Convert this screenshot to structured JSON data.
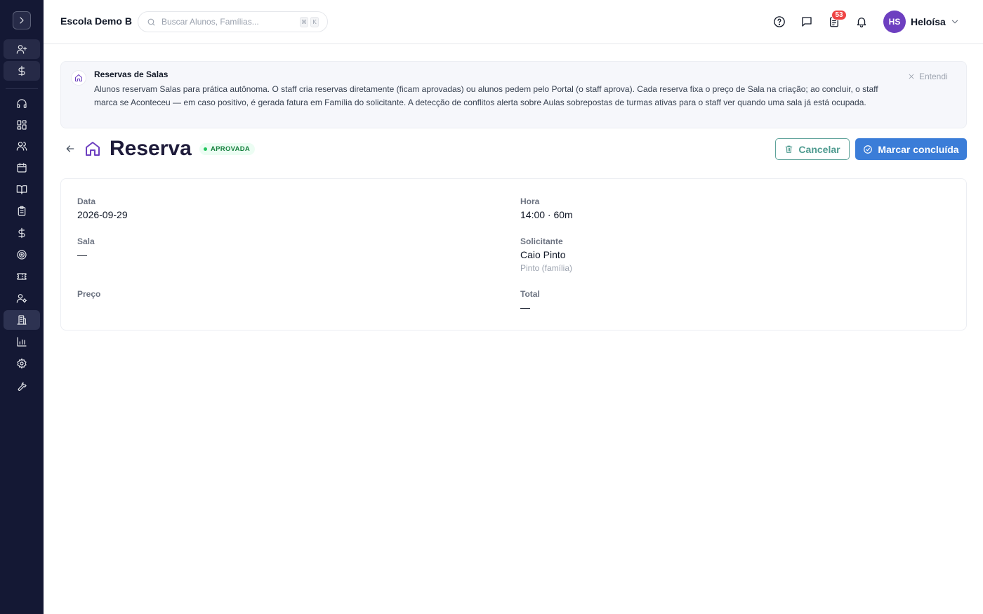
{
  "header": {
    "school_name": "Escola Demo B",
    "search_placeholder": "Buscar Alunos, Famílias...",
    "shortcut_keys": [
      "⌘",
      "K"
    ],
    "notification_count": "53",
    "user_initials": "HS",
    "user_name": "Heloísa"
  },
  "sidebar": {
    "items": [
      {
        "icon": "user-plus-icon"
      },
      {
        "icon": "dollar-icon"
      },
      {
        "icon": "headset-icon"
      },
      {
        "icon": "grid-icon"
      },
      {
        "icon": "users-icon"
      },
      {
        "icon": "calendar-icon"
      },
      {
        "icon": "book-icon"
      },
      {
        "icon": "clipboard-icon"
      },
      {
        "icon": "dollar-icon"
      },
      {
        "icon": "target-icon"
      },
      {
        "icon": "ticket-icon"
      },
      {
        "icon": "user-cog-icon"
      },
      {
        "icon": "building-icon",
        "active": true
      },
      {
        "icon": "bar-chart-icon"
      },
      {
        "icon": "settings-icon"
      },
      {
        "icon": "wrench-icon"
      }
    ]
  },
  "banner": {
    "title": "Reservas de Salas",
    "text": "Alunos reservam Salas para prática autônoma. O staff cria reservas diretamente (ficam aprovadas) ou alunos pedem pelo Portal (o staff aprova). Cada reserva fixa o preço de Sala na criação; ao concluir, o staff marca se Aconteceu — em caso positivo, é gerada fatura em Família do solicitante. A detecção de conflitos alerta sobre Aulas sobrepostas de turmas ativas para o staff ver quando uma sala já está ocupada.",
    "dismiss_label": "Entendi"
  },
  "page": {
    "title": "Reserva",
    "status": "APROVADA",
    "cancel_label": "Cancelar",
    "complete_label": "Marcar concluída"
  },
  "details": {
    "data_label": "Data",
    "data_value": "2026-09-29",
    "hora_label": "Hora",
    "hora_value": "14:00 · 60m",
    "sala_label": "Sala",
    "sala_value": "—",
    "solicitante_label": "Solicitante",
    "solicitante_value": "Caio Pinto",
    "solicitante_sub": "Pinto (família)",
    "preco_label": "Preço",
    "total_label": "Total",
    "total_value": "—"
  },
  "colors": {
    "sidebar_bg": "#141834",
    "accent_purple": "#6d3fc0",
    "primary_blue": "#3b7dd8",
    "cancel_teal": "#4f9b90",
    "status_green": "#15803d",
    "badge_red": "#ef4444"
  }
}
